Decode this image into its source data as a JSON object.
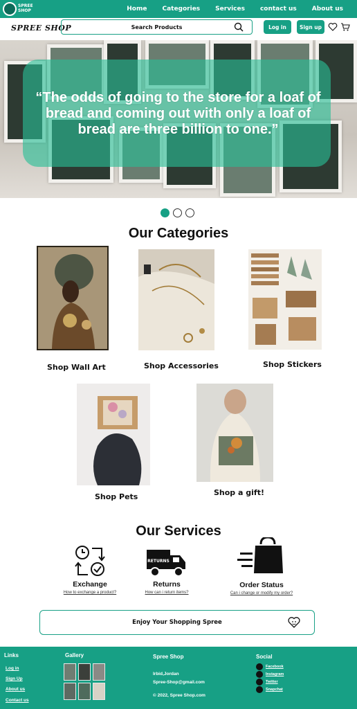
{
  "topbar": {
    "logo_text": "SPREE SHOP",
    "nav": [
      "Home",
      "Categories",
      "Services",
      "contact us",
      "About us"
    ]
  },
  "header": {
    "brand": "SPREE SHOP",
    "search_placeholder": "Search Products",
    "login_label": "Log in",
    "signup_label": "Sign up"
  },
  "hero": {
    "quote": "“The odds of going to the store for a loaf of bread and coming out with only a loaf of bread are three billion to one.”",
    "active_slide": 1,
    "slide_count": 3
  },
  "categories": {
    "title": "Our Categories",
    "items": [
      {
        "label": "Shop Wall Art"
      },
      {
        "label": "Shop Accessories"
      },
      {
        "label": "Shop Stickers"
      },
      {
        "label": "Shop Pets"
      },
      {
        "label": "Shop a gift!"
      }
    ]
  },
  "services": {
    "title": "Our Services",
    "items": [
      {
        "title": "Exchange",
        "link": "How to exchange a product?",
        "icon": "exchange-icon"
      },
      {
        "title": "Returns",
        "link": "How can i return items?",
        "icon": "returns-truck-icon"
      },
      {
        "title": "Order Status",
        "link": "Can i change or modify my order?",
        "icon": "shopping-bag-icon"
      }
    ]
  },
  "banner": {
    "text": "Enjoy Your Shopping Spree",
    "icon": "heart-face-icon"
  },
  "footer": {
    "links_title": "Links",
    "links": [
      "Log in",
      "Sign Up",
      "About us",
      "Contact us"
    ],
    "gallery_title": "Gallery",
    "shop_title": "Spree Shop",
    "address": "Irbid,Jordan",
    "email": "Spree-Shop@gmail.com",
    "copyright": "© 2022, Spree Shop.com",
    "social_title": "Social",
    "social": [
      "Facebook",
      "Instagram",
      "Twitter",
      "Snapchat"
    ]
  },
  "colors": {
    "accent": "#17a085",
    "footer": "#17a085"
  }
}
